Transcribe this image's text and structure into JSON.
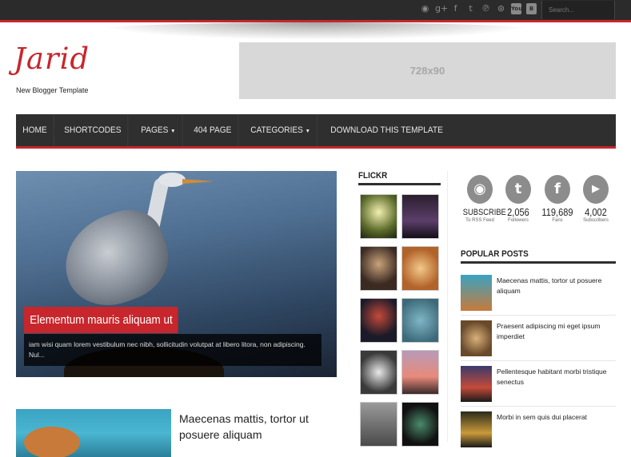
{
  "topbar": {
    "search_placeholder": "Search...",
    "social_icons": [
      "rss-icon",
      "google-plus-icon",
      "facebook-icon",
      "twitter-icon",
      "pinterest-icon",
      "dribbble-icon",
      "youtube-icon",
      "blogger-icon"
    ]
  },
  "header": {
    "logo": "Jarid",
    "tagline": "New Blogger Template",
    "ad_label": "728x90"
  },
  "nav": {
    "items": [
      {
        "label": "HOME"
      },
      {
        "label": "SHORTCODES"
      },
      {
        "label": "PAGES",
        "dropdown": true
      },
      {
        "label": "404 PAGE"
      },
      {
        "label": "CATEGORIES",
        "dropdown": true
      },
      {
        "label": "DOWNLOAD THIS TEMPLATE"
      }
    ]
  },
  "featured": {
    "title": "Elementum mauris aliquam ut",
    "excerpt": "iam wisi quam lorem vestibulum nec nibh, sollicitudin volutpat at libero litora, non adipiscing. Nul..."
  },
  "post2": {
    "title": "Maecenas mattis, tortor ut posuere aliquam"
  },
  "flickr": {
    "title": "FLICKR",
    "photo_count": 10
  },
  "counters": [
    {
      "icon": "rss-icon",
      "glyph": "◉",
      "value": "SUBSCRIBE",
      "label": "To RSS Feed"
    },
    {
      "icon": "twitter-icon",
      "glyph": "t",
      "value": "2,056",
      "label": "Followers"
    },
    {
      "icon": "facebook-icon",
      "glyph": "f",
      "value": "119,689",
      "label": "Fans"
    },
    {
      "icon": "youtube-icon",
      "glyph": "▶",
      "value": "4,002",
      "label": "Subscribers"
    }
  ],
  "popular": {
    "title": "POPULAR POSTS",
    "items": [
      {
        "title": "Maecenas mattis, tortor ut posuere aliquam"
      },
      {
        "title": "Praesent adipiscing mi eget ipsum imperdiet"
      },
      {
        "title": "Pellentesque habitant morbi tristique senectus"
      },
      {
        "title": "Morbi in sem quis dui placerat"
      }
    ]
  },
  "colors": {
    "accent": "#c7262c",
    "nav_bg": "#2f2f2f",
    "topbar_bg": "#2b2b2b"
  }
}
